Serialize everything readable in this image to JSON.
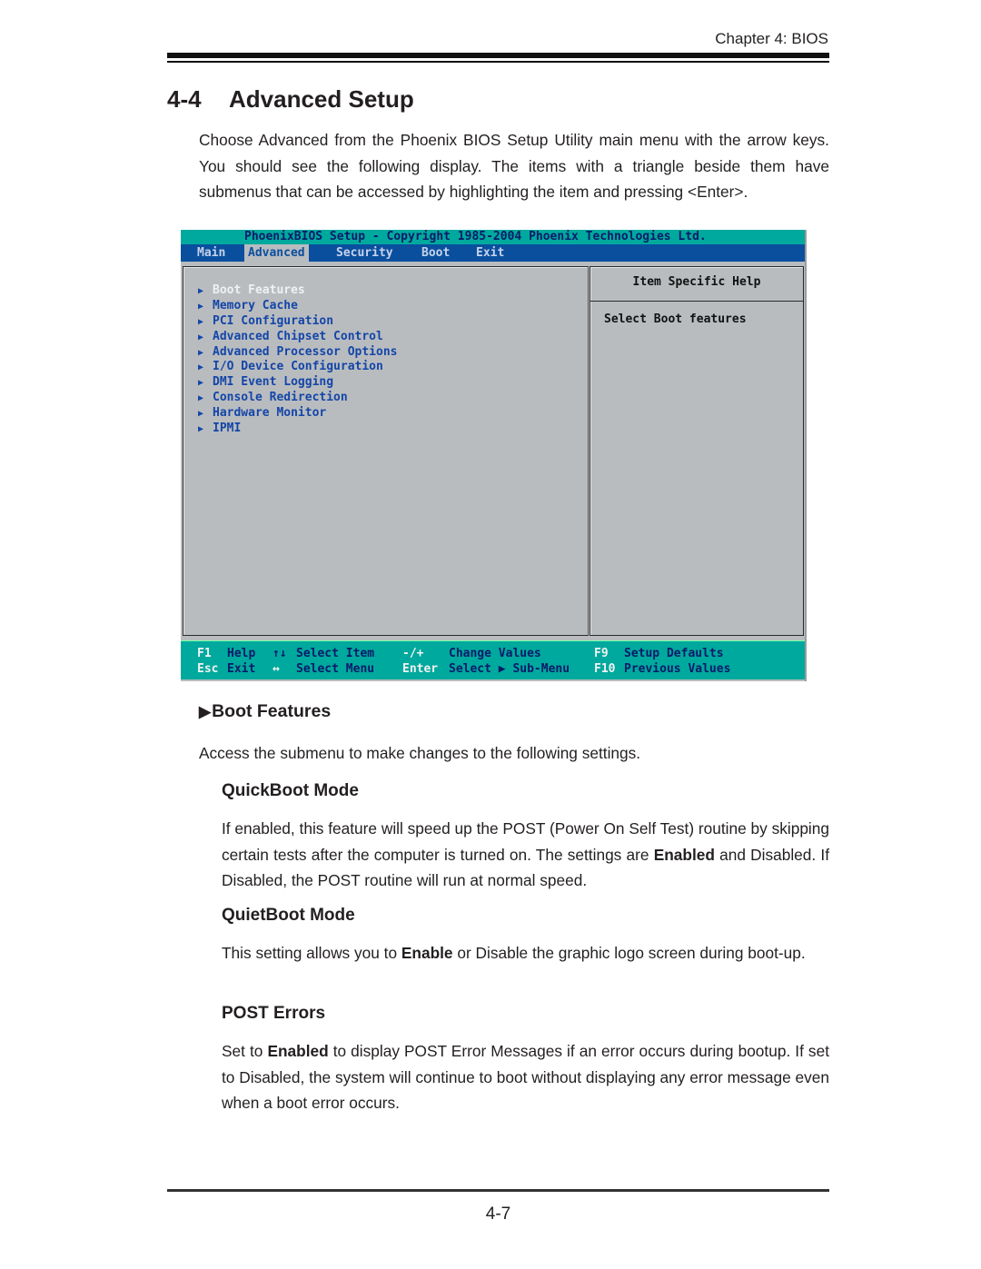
{
  "header": {
    "chapter": "Chapter 4: BIOS"
  },
  "section": {
    "number": "4-4",
    "title": "Advanced Setup",
    "intro": "Choose Advanced from the  Phoenix BIOS Setup Utility main menu with the arrow keys.  You should see the following display.  The items with a triangle beside them have submenus that can be accessed by highlighting the item and pressing <Enter>."
  },
  "bios": {
    "title": "PhoenixBIOS Setup - Copyright 1985-2004 Phoenix Technologies Ltd.",
    "tabs": [
      {
        "label": "Main",
        "active": false
      },
      {
        "label": "Advanced",
        "active": true
      },
      {
        "label": "Security",
        "active": false
      },
      {
        "label": "Boot",
        "active": false
      },
      {
        "label": "Exit",
        "active": false
      }
    ],
    "items": [
      {
        "label": "Boot Features",
        "icon": "triangle-right-icon",
        "selected": true
      },
      {
        "label": "Memory Cache",
        "icon": "triangle-right-icon",
        "selected": false
      },
      {
        "label": "PCI Configuration",
        "icon": "triangle-right-icon",
        "selected": false
      },
      {
        "label": "Advanced Chipset Control",
        "icon": "triangle-right-icon",
        "selected": false
      },
      {
        "label": "Advanced Processor Options",
        "icon": "triangle-right-icon",
        "selected": false
      },
      {
        "label": "I/O Device Configuration",
        "icon": "triangle-right-icon",
        "selected": false
      },
      {
        "label": "DMI Event Logging",
        "icon": "triangle-right-icon",
        "selected": false
      },
      {
        "label": "Console Redirection",
        "icon": "triangle-right-icon",
        "selected": false
      },
      {
        "label": "Hardware Monitor",
        "icon": "triangle-right-icon",
        "selected": false
      },
      {
        "label": "IPMI",
        "icon": "triangle-right-icon",
        "selected": false
      }
    ],
    "help": {
      "heading": "Item Specific Help",
      "text": "Select Boot features"
    },
    "footer": {
      "row1": [
        {
          "key": "F1",
          "desc": "Help"
        },
        {
          "key": "↑↓",
          "desc": "Select Item"
        },
        {
          "key": "-/+",
          "desc": "Change Values"
        },
        {
          "key": "F9",
          "desc": "Setup Defaults"
        }
      ],
      "row2": [
        {
          "key": "Esc",
          "desc": "Exit"
        },
        {
          "key": "↔",
          "desc": "Select Menu"
        },
        {
          "key": "Enter",
          "desc": "Select ▶ Sub-Menu"
        },
        {
          "key": "F10",
          "desc": "Previous Values"
        }
      ]
    },
    "colors": {
      "title_bar": "#00a99d",
      "menu_bar": "#0a4f9e",
      "panel": "#b9bcbf",
      "item_text": "#1446a8"
    }
  },
  "boot_features": {
    "heading": "Boot Features",
    "icon": "triangle-right-icon",
    "description": "Access the submenu to make changes to the following settings.",
    "settings": [
      {
        "title": "QuickBoot Mode",
        "text_parts": [
          {
            "t": "If enabled, this feature will speed up the POST (Power On Self Test) routine by skipping certain tests after the computer is turned on. The settings are ",
            "bold": false
          },
          {
            "t": "Enabled",
            "bold": true
          },
          {
            "t": " and Disabled. If Disabled, the POST routine will run at normal speed.",
            "bold": false
          }
        ]
      },
      {
        "title": "QuietBoot Mode",
        "text_parts": [
          {
            "t": "This setting allows you to ",
            "bold": false
          },
          {
            "t": "Enable",
            "bold": true
          },
          {
            "t": " or Disable the graphic logo screen during boot-up.",
            "bold": false
          }
        ]
      },
      {
        "title": "POST Errors",
        "text_parts": [
          {
            "t": "Set to ",
            "bold": false
          },
          {
            "t": "Enabled",
            "bold": true
          },
          {
            "t": " to display POST Error Messages if an error occurs during bootup. If set to Disabled, the system will continue to boot without displaying any error message even when a boot error occurs.",
            "bold": false
          }
        ]
      }
    ]
  },
  "footer": {
    "page_number": "4-7"
  }
}
